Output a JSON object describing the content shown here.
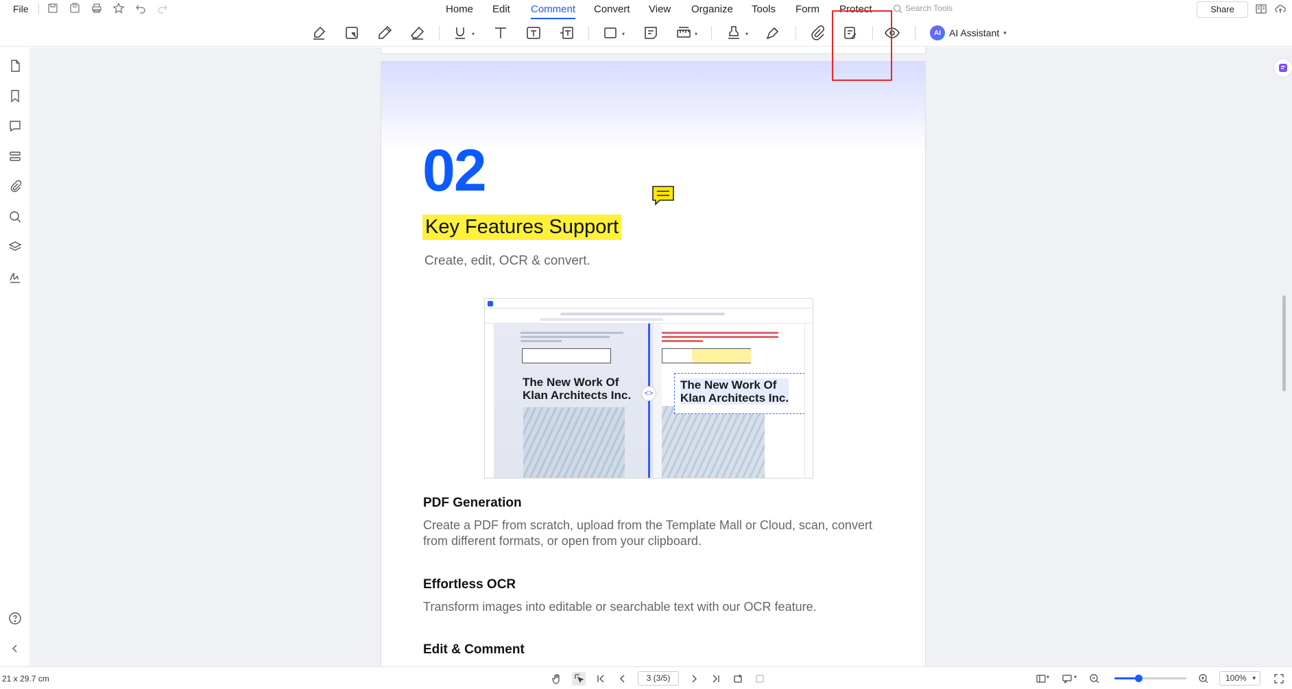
{
  "menubar": {
    "file": "File",
    "items": [
      "Home",
      "Edit",
      "Comment",
      "Convert",
      "View",
      "Organize",
      "Tools",
      "Form",
      "Protect"
    ],
    "active": "Comment",
    "search_placeholder": "Search Tools",
    "share": "Share"
  },
  "toolbar": {
    "ai_badge": "AI",
    "ai_label": "AI Assistant"
  },
  "document": {
    "section_number": "02",
    "title": "Key Features Support",
    "subtitle": "Create, edit, OCR & convert.",
    "embedded_screenshot": {
      "left_heading_line1": "The New Work Of",
      "left_heading_line2": "Klan Architects Inc.",
      "right_heading_line1": "The New Work Of",
      "right_heading_line2": "Klan Architects Inc."
    },
    "sections": [
      {
        "heading": "PDF Generation",
        "body": "Create a PDF from scratch, upload from the Template Mall or Cloud, scan, convert from different formats, or open from your clipboard."
      },
      {
        "heading": "Effortless OCR",
        "body": "Transform images into editable or searchable text with our OCR feature."
      },
      {
        "heading": "Edit & Comment",
        "body": ""
      }
    ]
  },
  "statusbar": {
    "page_size": "21 x 29.7 cm",
    "page_indicator": "3 (3/5)",
    "zoom": "100%",
    "zoom_fraction": 0.33
  },
  "colors": {
    "accent": "#1a5cff",
    "highlight": "#fff03a",
    "section_number": "#0d5bff",
    "annotation_box": "#e8262a"
  }
}
